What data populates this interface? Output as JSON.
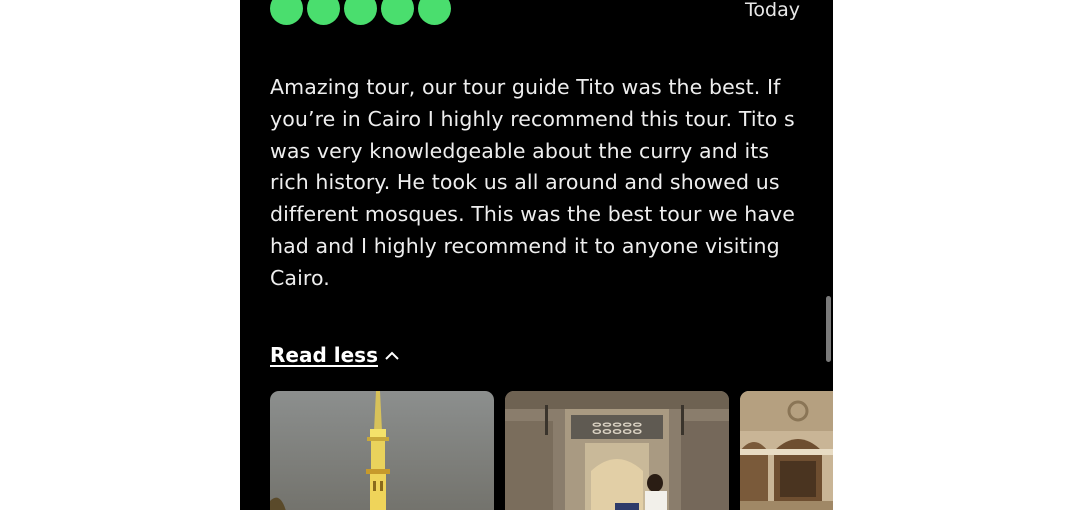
{
  "review": {
    "rating": 5,
    "rating_max": 5,
    "date": "Today",
    "text": "Amazing tour, our tour guide Tito was the best. If you’re in Cairo I highly recommend this tour. Tito s was very knowledgeable about the curry and its rich history. He took us all around and showed us different mosques. This was the best tour we have had and I highly recommend it to anyone visiting Cairo.",
    "read_less_label": "Read less",
    "photos": [
      {
        "icon": "minaret-night-photo"
      },
      {
        "icon": "mosque-doorway-photo"
      },
      {
        "icon": "mosque-arches-photo"
      }
    ]
  },
  "colors": {
    "rating_bubble": "#4ade6e",
    "panel_background": "#000000",
    "text": "#eeeeee"
  }
}
